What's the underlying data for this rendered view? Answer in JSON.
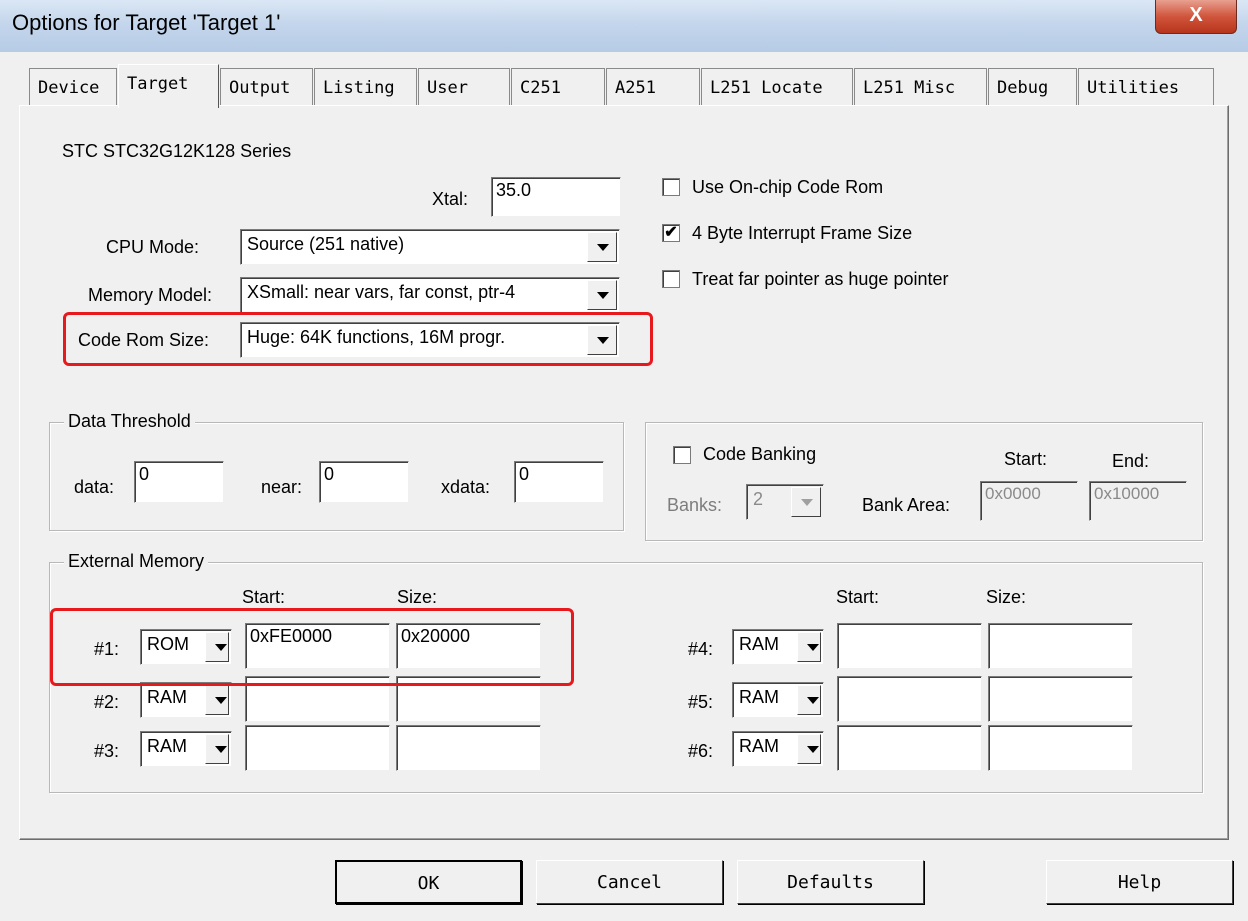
{
  "window": {
    "title": "Options for Target 'Target 1'",
    "close_glyph": "X"
  },
  "tabs": [
    {
      "label": "Device"
    },
    {
      "label": "Target"
    },
    {
      "label": "Output"
    },
    {
      "label": "Listing"
    },
    {
      "label": "User"
    },
    {
      "label": "C251"
    },
    {
      "label": "A251"
    },
    {
      "label": "L251 Locate"
    },
    {
      "label": "L251 Misc"
    },
    {
      "label": "Debug"
    },
    {
      "label": "Utilities"
    }
  ],
  "selected_tab": "Target",
  "device_name": "STC STC32G12K128 Series",
  "xtal": {
    "label": "Xtal:",
    "value": "35.0"
  },
  "cpu_mode": {
    "label": "CPU Mode:",
    "value": "Source (251 native)"
  },
  "memory_model": {
    "label": "Memory Model:",
    "value": "XSmall: near vars, far const, ptr-4"
  },
  "code_rom_size": {
    "label": "Code Rom Size:",
    "value": "Huge: 64K functions, 16M progr."
  },
  "options": [
    {
      "label": "Use On-chip Code Rom",
      "checked": false
    },
    {
      "label": "4 Byte Interrupt Frame Size",
      "checked": true
    },
    {
      "label": "Treat far pointer as huge pointer",
      "checked": false
    }
  ],
  "check_glyph": "✔",
  "data_threshold": {
    "title": "Data Threshold",
    "data_label": "data:",
    "data_value": "0",
    "near_label": "near:",
    "near_value": "0",
    "xdata_label": "xdata:",
    "xdata_value": "0"
  },
  "code_banking": {
    "label": "Code Banking",
    "checked": false,
    "banks_label": "Banks:",
    "banks_value": "2",
    "start_header": "Start:",
    "end_header": "End:",
    "bank_area_label": "Bank Area:",
    "start_value": "0x0000",
    "end_value": "0x10000"
  },
  "external_memory": {
    "title": "External Memory",
    "start_header": "Start:",
    "size_header": "Size:",
    "rows_left": [
      {
        "label": "#1:",
        "type": "ROM",
        "start": "0xFE0000",
        "size": "0x20000"
      },
      {
        "label": "#2:",
        "type": "RAM",
        "start": "",
        "size": ""
      },
      {
        "label": "#3:",
        "type": "RAM",
        "start": "",
        "size": ""
      }
    ],
    "rows_right": [
      {
        "label": "#4:",
        "type": "RAM",
        "start": "",
        "size": ""
      },
      {
        "label": "#5:",
        "type": "RAM",
        "start": "",
        "size": ""
      },
      {
        "label": "#6:",
        "type": "RAM",
        "start": "",
        "size": ""
      }
    ]
  },
  "buttons": {
    "ok": "OK",
    "cancel": "Cancel",
    "defaults": "Defaults",
    "help": "Help"
  },
  "colors": {
    "highlight_box": "#e8191c",
    "title_bar": "#c4d6ec",
    "close_button": "#c84a32"
  }
}
